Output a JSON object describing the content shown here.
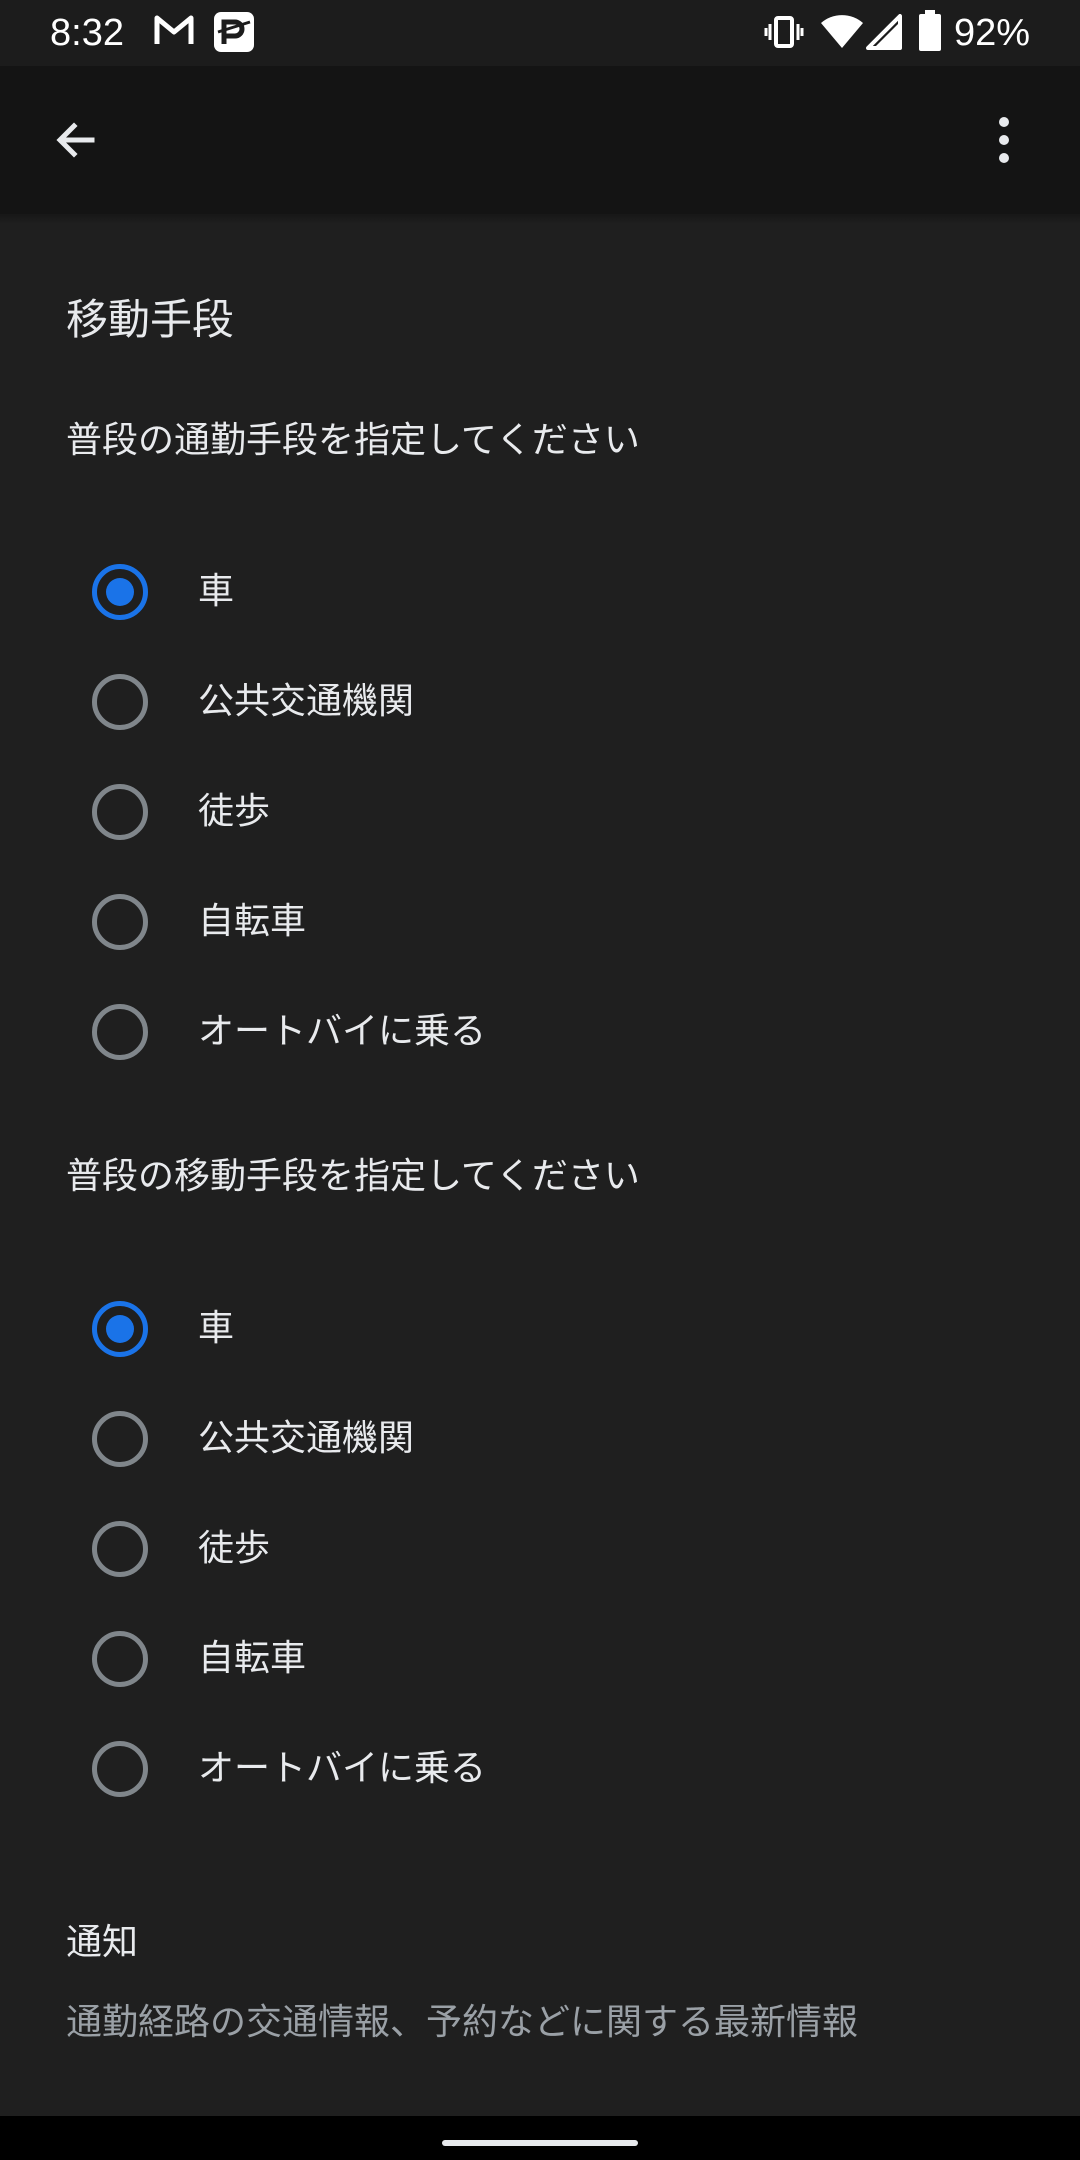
{
  "status_bar": {
    "time": "8:32",
    "battery": "92%",
    "icons": [
      "gmail-icon",
      "paypay-icon",
      "vibrate-icon",
      "wifi-icon",
      "cell-signal-icon",
      "battery-icon"
    ]
  },
  "app_bar": {
    "back_icon": "arrow-back-icon",
    "menu_icon": "more-vert-icon"
  },
  "section": {
    "title": "移動手段"
  },
  "commute": {
    "question": "普段の通勤手段を指定してください",
    "options": [
      "車",
      "公共交通機関",
      "徒歩",
      "自転車",
      "オートバイに乗る"
    ],
    "selected": "車"
  },
  "travel": {
    "question": "普段の移動手段を指定してください",
    "options": [
      "車",
      "公共交通機関",
      "徒歩",
      "自転車",
      "オートバイに乗る"
    ],
    "selected": "車"
  },
  "notifications": {
    "title": "通知",
    "description": "通勤経路の交通情報、予約などに関する最新情報"
  },
  "colors": {
    "background": "#1f1f1f",
    "app_bar": "#141414",
    "accent": "#1a73e8",
    "text_primary": "#e8eaed",
    "text_secondary": "#9aa0a6",
    "radio_unchecked": "#80868b"
  }
}
